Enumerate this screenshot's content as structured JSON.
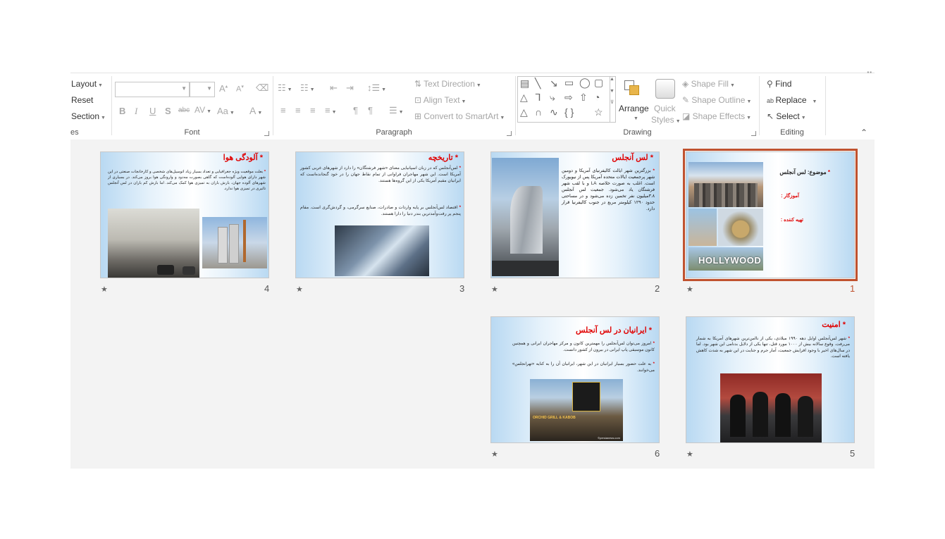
{
  "ribbon": {
    "slides_group": {
      "layout": "Layout",
      "reset": "Reset",
      "section": "Section",
      "label": "es"
    },
    "font_group": {
      "font_name": "",
      "font_size": "",
      "label": "Font"
    },
    "paragraph_group": {
      "text_direction": "Text Direction",
      "align_text": "Align Text",
      "convert_smartart": "Convert to SmartArt",
      "label": "Paragraph"
    },
    "drawing_group": {
      "arrange": "Arrange",
      "quick_styles_1": "Quick",
      "quick_styles_2": "Styles",
      "shape_fill": "Shape Fill",
      "shape_outline": "Shape Outline",
      "shape_effects": "Shape Effects",
      "label": "Drawing"
    },
    "editing_group": {
      "find": "Find",
      "replace": "Replace",
      "select": "Select",
      "label": "Editing"
    }
  },
  "slides": [
    {
      "number": "1",
      "selected": true,
      "lines": [
        "موضوع: لس آنجلس",
        "آموزگار :",
        "تهیه کننده :"
      ],
      "photo_text": "HOLLYWOOD"
    },
    {
      "number": "2",
      "title": "لس آنجلس",
      "body": "بزرگترین شهر ایالت کالیفرنیای آمریکا و دومین شهر پرجمعیت ایالات متحده آمریکا پس از نیویورک است. اغلب به صورت خلاصه LA و با لقب شهر فرشتگان یاد می‌شود. جمعیت لس آنجلس ۳.۸میلیون نفر تخمین زده می‌شود و در مساحتی حدود ۱۲۹۰ کیلومتر مربع در جنوب کالیفرنیا قرار دارد."
    },
    {
      "number": "3",
      "title": "تاریخچه",
      "body1": "لس‌آنجلس که در زبان اسپانیایی معنای «شهر فرشتگان» را دارد از شهرهای غربی کشور آمریکا است. این شهر مهاجران فراوانی از تمام نقاط جهان را در خود گنجانده‌است که ایرانیان مقیم آمریکا یکی از این گروه‌ها هستند.",
      "body2": "اقتصاد لس‌آنجلس بر پایه واردات و صادرات، صنایع سرگرمی، و گردش‌گری است. مقام پنجم پر رفت‌وآمدترین بندر دنیا را دارا هستند."
    },
    {
      "number": "4",
      "title": "آلودگی هوا",
      "body": "بعلت موقعیت ویژه جغرافیایی و تعداد بسیار زیاد اتومبیل‌های شخصی و کارخانجات صنعتی در این شهر دارای هوایی آلوده‌است که گاهی بصورت مه‌دود و وارونگی هوا بروز می‌کند. در بسیاری از شهرهای آلوده جهان، بارش باران به تمیزی هوا کمک می‌کند. اما بارش کم باران در لس آنجلس تاثیری در تمیزی هوا ندارد."
    },
    {
      "number": "5",
      "title": "امنیت",
      "body": "شهر لس‌آنجلس اوایل دهه ۱۹۹۰ میلادی، یکی از ناامن‌ترین شهرهای آمریکا به شمار می‌رفت. وقوع سالانه بیش از ۱۰۰۰ مورد قتل، تنها یکی از دلایل بدنامی این شهر بود. اما در سال‌های اخیر با وجود افزایش جمعیت، آمار جرم و جنایت در این شهر به شدت کاهش یافته است."
    },
    {
      "number": "6",
      "title": "ایرانیان در لس آنجلس",
      "body1": "امروز می‌توان لس‌آنجلس را مهمترین کانون و مرکز مهاجران ایرانی و همچنین کانون موسیقی پاپ ایرانی در بیرون از کشور دانست.",
      "body2": "به علت حضور بسیار ایرانیان در این شهر، ایرانیان آن را به کنایه «تهرانجلس» می‌خوانند.",
      "sign_text": "ORCHID GRILL & KABOB",
      "credit": "©persianews.com"
    }
  ]
}
